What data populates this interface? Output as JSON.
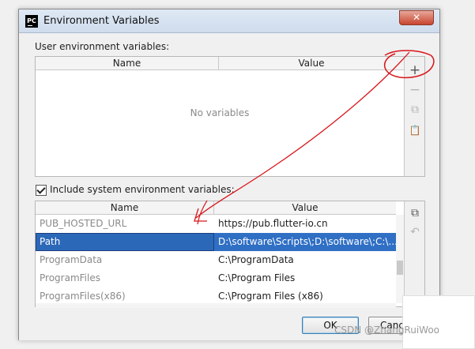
{
  "window": {
    "app_icon_text": "PC",
    "title": "Environment Variables",
    "close_symbol": "✕"
  },
  "user_vars": {
    "label": "User environment variables:",
    "columns": [
      "Name",
      "Value"
    ],
    "empty_text": "No variables",
    "toolbar_icons": [
      "plus-icon",
      "minus-icon",
      "copy-icon",
      "paste-icon"
    ],
    "toolbar_glyphs": [
      "+",
      "−",
      "⧉",
      "📋"
    ]
  },
  "system_vars": {
    "checkbox_label": "Include system environment variables:",
    "checked": true,
    "columns": [
      "Name",
      "Value"
    ],
    "rows": [
      {
        "name": "PUB_HOSTED_URL",
        "value": "https://pub.flutter-io.cn"
      },
      {
        "name": "Path",
        "value": "D:\\software\\Scripts\\;D:\\software\\;C:\\...",
        "selected": true
      },
      {
        "name": "ProgramData",
        "value": "C:\\ProgramData"
      },
      {
        "name": "ProgramFiles",
        "value": "C:\\Program Files"
      },
      {
        "name": "ProgramFiles(x86)",
        "value": "C:\\Program Files (x86)"
      }
    ],
    "toolbar_icons": [
      "copy-icon",
      "undo-icon"
    ],
    "toolbar_glyphs": [
      "⧉",
      "↶"
    ]
  },
  "buttons": {
    "ok": "OK",
    "cancel": "Cance"
  },
  "watermark": "CSDN @ZhangRuiWoo",
  "colors": {
    "selection": "#2f6fc4",
    "annotation_red": "#d9151a"
  }
}
